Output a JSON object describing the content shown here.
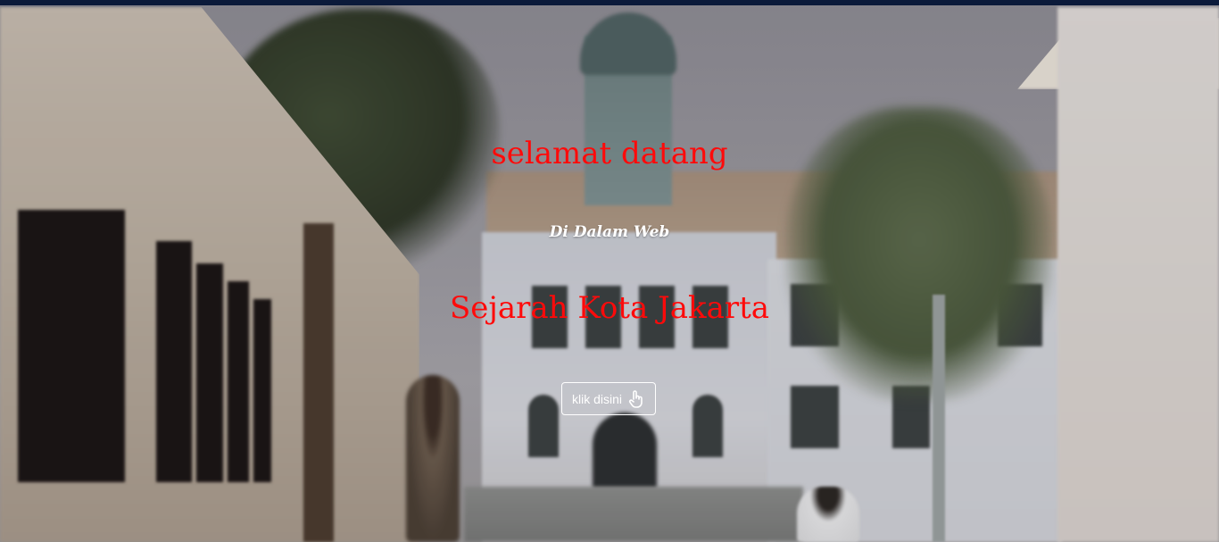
{
  "hero": {
    "title_line1": "selamat datang",
    "subtitle": "Di Dalam Web",
    "title_line2": "Sejarah Kota Jakarta",
    "accent_color": "#ff0a0a",
    "background_image": "blurred photo of a colonial-era building with a clock tower (Kota Tua Jakarta)"
  },
  "cta_button": {
    "label": "klik disini",
    "icon": "pointer-hand-icon"
  },
  "top_bar": {
    "color": "#0b1a3a"
  }
}
